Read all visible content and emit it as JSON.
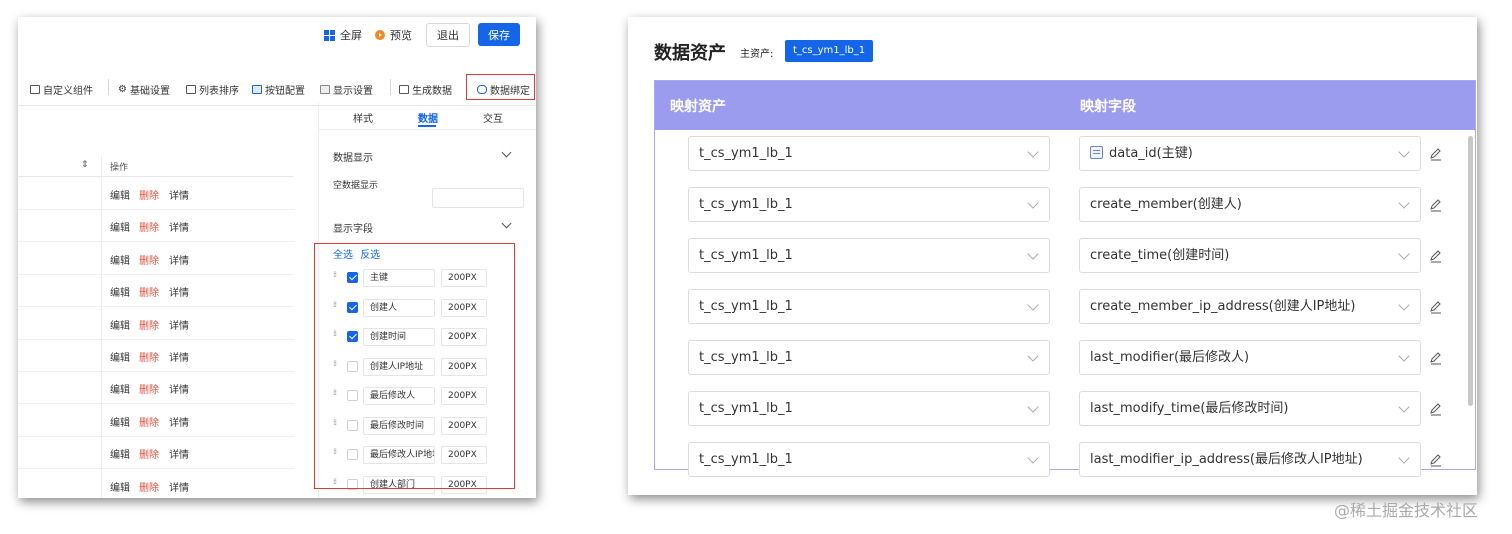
{
  "left": {
    "topbar": {
      "fullscreen": "全屏",
      "preview": "预览",
      "exit": "退出",
      "save": "保存"
    },
    "toolbar": [
      "自定义组件",
      "基础设置",
      "列表排序",
      "按钮配置",
      "显示设置",
      "生成数据",
      "数据绑定"
    ],
    "table": {
      "sort_icon": "⇕",
      "action_header": "操作",
      "actions": {
        "edit": "编辑",
        "delete": "删除",
        "detail": "详情"
      },
      "row_count": 10
    },
    "panel": {
      "tabs": [
        "样式",
        "数据",
        "交互"
      ],
      "active_tab": "数据",
      "data_display_title": "数据显示",
      "empty_display_label": "空数据显示",
      "display_fields_title": "显示字段",
      "select_all": "全选",
      "invert_select": "反选",
      "fields": [
        {
          "name": "主键",
          "width": "200PX",
          "checked": true
        },
        {
          "name": "创建人",
          "width": "200PX",
          "checked": true
        },
        {
          "name": "创建时间",
          "width": "200PX",
          "checked": true
        },
        {
          "name": "创建人IP地址",
          "width": "200PX",
          "checked": false
        },
        {
          "name": "最后修改人",
          "width": "200PX",
          "checked": false
        },
        {
          "name": "最后修改时间",
          "width": "200PX",
          "checked": false
        },
        {
          "name": "最后修改人IP地址",
          "width": "200PX",
          "checked": false
        },
        {
          "name": "创建人部门",
          "width": "200PX",
          "checked": false
        }
      ]
    },
    "accent": "#1565e8",
    "highlight": "#e53935"
  },
  "right": {
    "title": "数据资产",
    "main_asset_label": "主资产:",
    "main_asset_value": "t_cs_ym1_lb_1",
    "headers": {
      "asset": "映射资产",
      "field": "映射字段"
    },
    "rows": [
      {
        "asset": "t_cs_ym1_lb_1",
        "field": "data_id(主键)",
        "key": true
      },
      {
        "asset": "t_cs_ym1_lb_1",
        "field": "create_member(创建人)",
        "key": false
      },
      {
        "asset": "t_cs_ym1_lb_1",
        "field": "create_time(创建时间)",
        "key": false
      },
      {
        "asset": "t_cs_ym1_lb_1",
        "field": "create_member_ip_address(创建人IP地址)",
        "key": false
      },
      {
        "asset": "t_cs_ym1_lb_1",
        "field": "last_modifier(最后修改人)",
        "key": false
      },
      {
        "asset": "t_cs_ym1_lb_1",
        "field": "last_modify_time(最后修改时间)",
        "key": false
      },
      {
        "asset": "t_cs_ym1_lb_1",
        "field": "last_modifier_ip_address(最后修改人IP地址)",
        "key": false
      }
    ],
    "header_color": "#9c9cef"
  },
  "watermark": "@稀土掘金技术社区"
}
